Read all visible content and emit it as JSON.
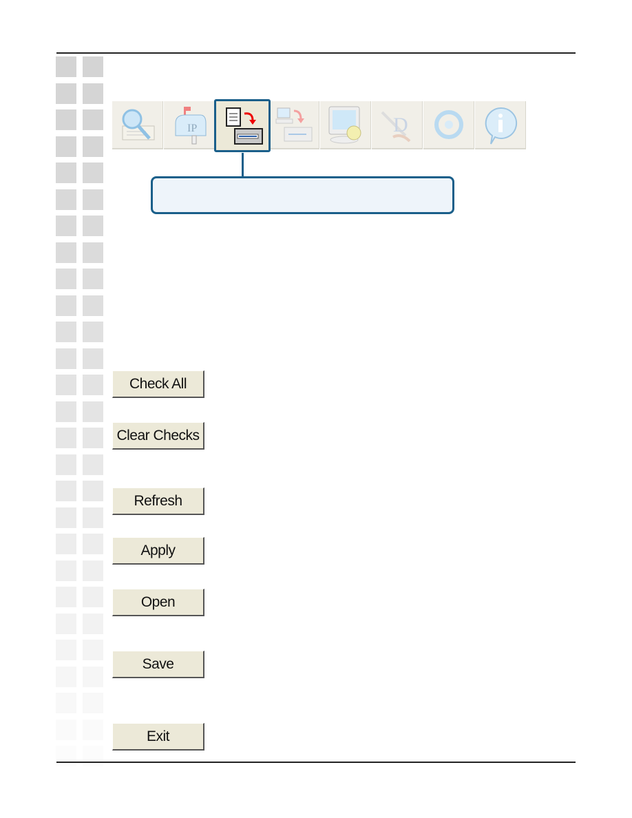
{
  "toolbar": {
    "items": [
      {
        "name": "discovery-icon",
        "selected": false
      },
      {
        "name": "ip-mailbox-icon",
        "selected": false
      },
      {
        "name": "config-to-device-icon",
        "selected": true
      },
      {
        "name": "firmware-to-device-icon",
        "selected": false
      },
      {
        "name": "system-settings-icon",
        "selected": false
      },
      {
        "name": "dlink-tool-icon",
        "selected": false
      },
      {
        "name": "refresh-cycle-icon",
        "selected": false
      },
      {
        "name": "info-icon",
        "selected": false
      }
    ],
    "accent_color": "#1a5f8a"
  },
  "buttons": {
    "check_all": "Check All",
    "clear_checks": "Clear Checks",
    "refresh": "Refresh",
    "apply": "Apply",
    "open": "Open",
    "save": "Save",
    "exit": "Exit"
  }
}
